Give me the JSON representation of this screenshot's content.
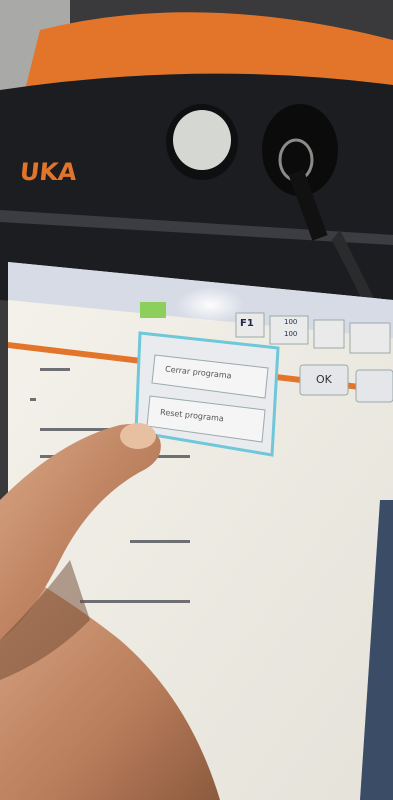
{
  "image": {
    "brand_text": "UKA",
    "popup": {
      "options": [
        "Cerrar programa",
        "Reset programa"
      ]
    },
    "buttons": {
      "ok": "OK",
      "status_f": "F1",
      "status_speed_top": "100",
      "status_speed_bottom": "100"
    }
  },
  "colors": {
    "housing": "#1c1d20",
    "orange": "#e3752a",
    "screen": "#f1eee5",
    "popup_border": "#6fc7da",
    "skin": "#c7906c"
  }
}
